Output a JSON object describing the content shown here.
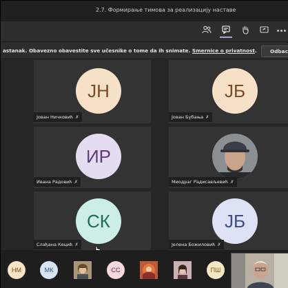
{
  "window": {
    "title": "2.7. Формирање тимова за реализацију наставе"
  },
  "toolbar": {
    "icons": [
      "people-icon",
      "chat-icon",
      "raise-hand-icon",
      "share-tray-icon",
      "more-options-icon"
    ],
    "more_label": "•••"
  },
  "banner": {
    "message": "astanak. Obavezno obavestite sve učesnike o tome da ih snimate. ",
    "link_text": "Smernice o privatnost",
    "link_suffix": ".",
    "dismiss_label": "Odbaci"
  },
  "participants": [
    {
      "initials": "ЈН",
      "name": "Јован Ничковић",
      "color": "#f7e0c8"
    },
    {
      "initials": "ЈБ",
      "name": "Јован Бубања",
      "color": "#f7e0c8"
    },
    {
      "initials": "ИР",
      "name": "Ивана Радовић",
      "color": "#e6dcf2"
    },
    {
      "initials": "",
      "name": "Миодраг Радисављевић",
      "photo": true
    },
    {
      "initials": "СК",
      "name": "Слађана Кецић",
      "color": "#cdeee6"
    },
    {
      "initials": "ЈБ",
      "name": "Јелена Божиловић",
      "color": "#dde2f5"
    }
  ],
  "strip": {
    "items": [
      {
        "initials": "НМ"
      },
      {
        "initials": "МК"
      },
      {
        "initials": "",
        "photo": true
      },
      {
        "initials": "СС"
      },
      {
        "initials": "",
        "photo": true
      },
      {
        "initials": "",
        "photo": true
      },
      {
        "initials": "ПШ"
      }
    ]
  },
  "mic_icon": "✗"
}
